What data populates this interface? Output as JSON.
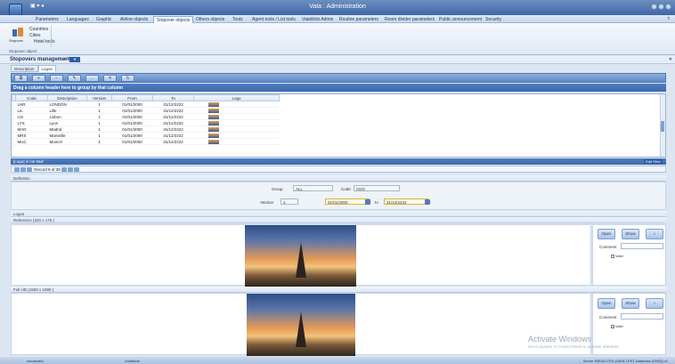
{
  "window": {
    "title": "Vata : Administration"
  },
  "menu": {
    "tabs": [
      {
        "label": "Parameters"
      },
      {
        "label": "Languages"
      },
      {
        "label": "Graphic"
      },
      {
        "label": "Airline objects"
      },
      {
        "label": "Stopover objects"
      },
      {
        "label": "Others objects"
      },
      {
        "label": "Tools"
      },
      {
        "label": "Agent tools / List tools"
      },
      {
        "label": "VataWeb Admin"
      },
      {
        "label": "Routine parameters"
      },
      {
        "label": "Room divider parameters"
      },
      {
        "label": "Public announcement"
      },
      {
        "label": "Security"
      }
    ],
    "active": "Stopover objects",
    "help": "?"
  },
  "ribbon": {
    "big_label": "Stopover",
    "items": [
      "Countries",
      "Cities",
      "Hotel tools"
    ],
    "group_label": "Stopover object"
  },
  "document": {
    "tab": "Stopovers management",
    "pin": "▼"
  },
  "subtabs": [
    "Description",
    "Logos"
  ],
  "toolbar": {
    "buttons": [
      "⧉",
      "+",
      "−",
      "✎",
      "←",
      "✕",
      "↻"
    ]
  },
  "grid": {
    "group_hint": "Drag a column header here to group by that column",
    "columns": [
      "Code",
      "Description",
      "Version",
      "From",
      "To",
      "Logo"
    ],
    "rows": [
      {
        "code": "LHR",
        "description": "LONDON",
        "version": "1",
        "from": "01/01/2000",
        "to": "31/12/2222"
      },
      {
        "code": "LIL",
        "description": "Lille",
        "version": "1",
        "from": "01/01/2000",
        "to": "31/12/2222"
      },
      {
        "code": "LIS",
        "description": "Lisbon",
        "version": "1",
        "from": "01/01/2000",
        "to": "31/12/2222"
      },
      {
        "code": "LYS",
        "description": "Lyon",
        "version": "1",
        "from": "01/01/2000",
        "to": "31/12/2222"
      },
      {
        "code": "MAD",
        "description": "Madrid",
        "version": "1",
        "from": "01/01/2000",
        "to": "31/12/2222"
      },
      {
        "code": "MRS",
        "description": "Marseille",
        "version": "1",
        "from": "01/01/2000",
        "to": "31/12/2222"
      },
      {
        "code": "MUC",
        "description": "Munich",
        "version": "1",
        "from": "01/01/2000",
        "to": "31/12/2222"
      }
    ]
  },
  "filterbar": {
    "text": "[Logo] is not Null",
    "edit": "Edit Filter"
  },
  "navbar": {
    "record": "Record 6 of 36"
  },
  "definition": {
    "header": "Definition",
    "group_label": "Group",
    "group_value": "ALL",
    "code_label": "Code",
    "code_value": "CDG",
    "version_label": "Version",
    "version_value": "1",
    "from_value": "01/01/2000",
    "to_label": "to",
    "to_value": "31/12/2222"
  },
  "logos": {
    "header": "Logos",
    "reference_label": "Reference (320 x 175 )",
    "fullhd_label": "Full HD (1920 x 1080 )"
  },
  "side": {
    "open": "Open",
    "show": "Show",
    "comment_label": "Comment",
    "valid_label": "Valid"
  },
  "status": {
    "left": "connected",
    "middle": "Vodafone",
    "right": "Server REDACTED (VATA TEST Database (ENG)) v1"
  },
  "watermark": {
    "title": "Activate Windows",
    "sub": "Go to System in Control Panel to activate Windows."
  }
}
